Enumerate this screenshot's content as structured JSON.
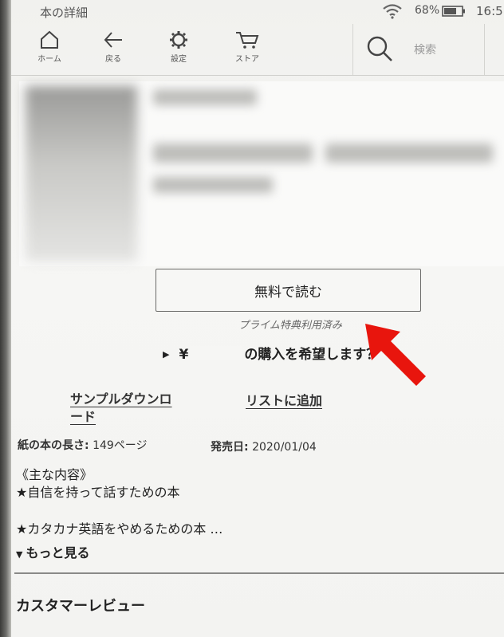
{
  "status_bar": {
    "title": "本の詳細",
    "battery_percent": "68%",
    "clock": "16:5"
  },
  "toolbar": {
    "items": [
      {
        "label": "ホーム",
        "icon": "home-icon"
      },
      {
        "label": "戻る",
        "icon": "back-arrow-icon"
      },
      {
        "label": "設定",
        "icon": "settings-icon"
      },
      {
        "label": "ストア",
        "icon": "cart-icon"
      }
    ],
    "search_placeholder": "検索"
  },
  "actions": {
    "read_free_label": "無料で読む",
    "prime_note": "プライム特典利用済み",
    "purchase_prefix": "¥",
    "purchase_suffix": "の購入を希望します？",
    "sample_download_label": "サンプルダウンロード",
    "add_to_list_label": "リストに追加"
  },
  "details": {
    "pages_key": "紙の本の長さ:",
    "pages_value": "149ページ",
    "release_key": "発売日:",
    "release_value": "2020/01/04"
  },
  "description": {
    "heading": "《主な内容》",
    "line1": "★自信を持って話すための本",
    "line2": "★カタカナ英語をやめるための本 …",
    "more_label": "もっと見る"
  },
  "reviews": {
    "heading": "カスタマーレビュー"
  },
  "colors": {
    "annotation_arrow": "#e8150d"
  }
}
